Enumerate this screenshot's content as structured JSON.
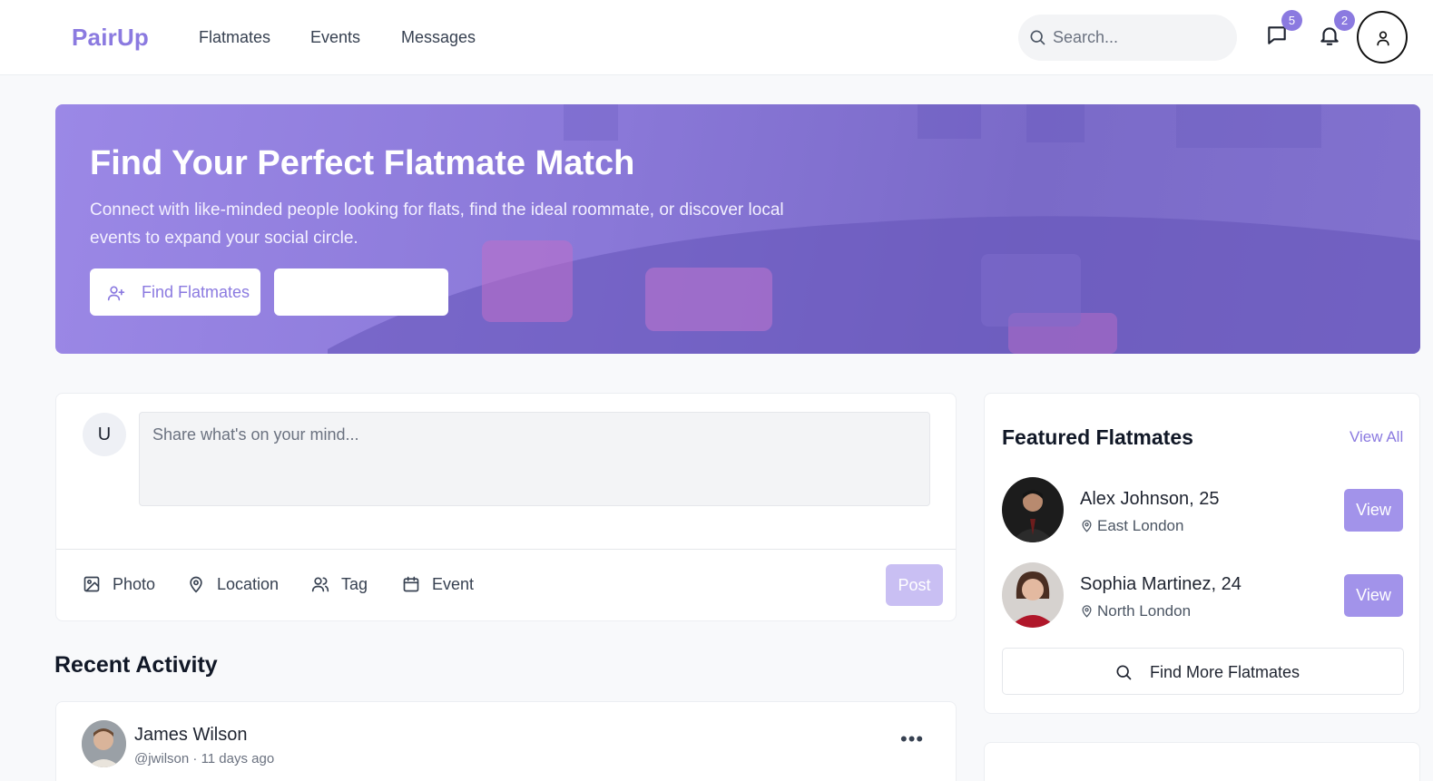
{
  "brand": {
    "name": "PairUp",
    "accent": "#8b7ae0"
  },
  "nav": {
    "items": [
      "Flatmates",
      "Events",
      "Messages"
    ]
  },
  "search": {
    "placeholder": "Search..."
  },
  "header_icons": {
    "messages_badge": "5",
    "notifications_badge": "2"
  },
  "hero": {
    "title": "Find Your Perfect Flatmate Match",
    "subtitle": "Connect with like-minded people looking for flats, find the ideal roommate, or discover local events to expand your social circle.",
    "primary_button": "Find Flatmates",
    "secondary_button": ""
  },
  "composer": {
    "avatar_initial": "U",
    "placeholder": "Share what's on your mind...",
    "actions": [
      "Photo",
      "Location",
      "Tag",
      "Event"
    ],
    "post_label": "Post"
  },
  "recent_activity": {
    "title": "Recent Activity",
    "items": [
      {
        "name": "James Wilson",
        "handle": "@jwilson",
        "time": "11 days ago",
        "meta": "@jwilson · 11 days ago"
      }
    ]
  },
  "featured": {
    "title": "Featured Flatmates",
    "view_all": "View All",
    "people": [
      {
        "name": "Alex Johnson, 25",
        "location": "East London",
        "button": "View"
      },
      {
        "name": "Sophia Martinez, 24",
        "location": "North London",
        "button": "View"
      }
    ],
    "find_more": "Find More Flatmates"
  }
}
